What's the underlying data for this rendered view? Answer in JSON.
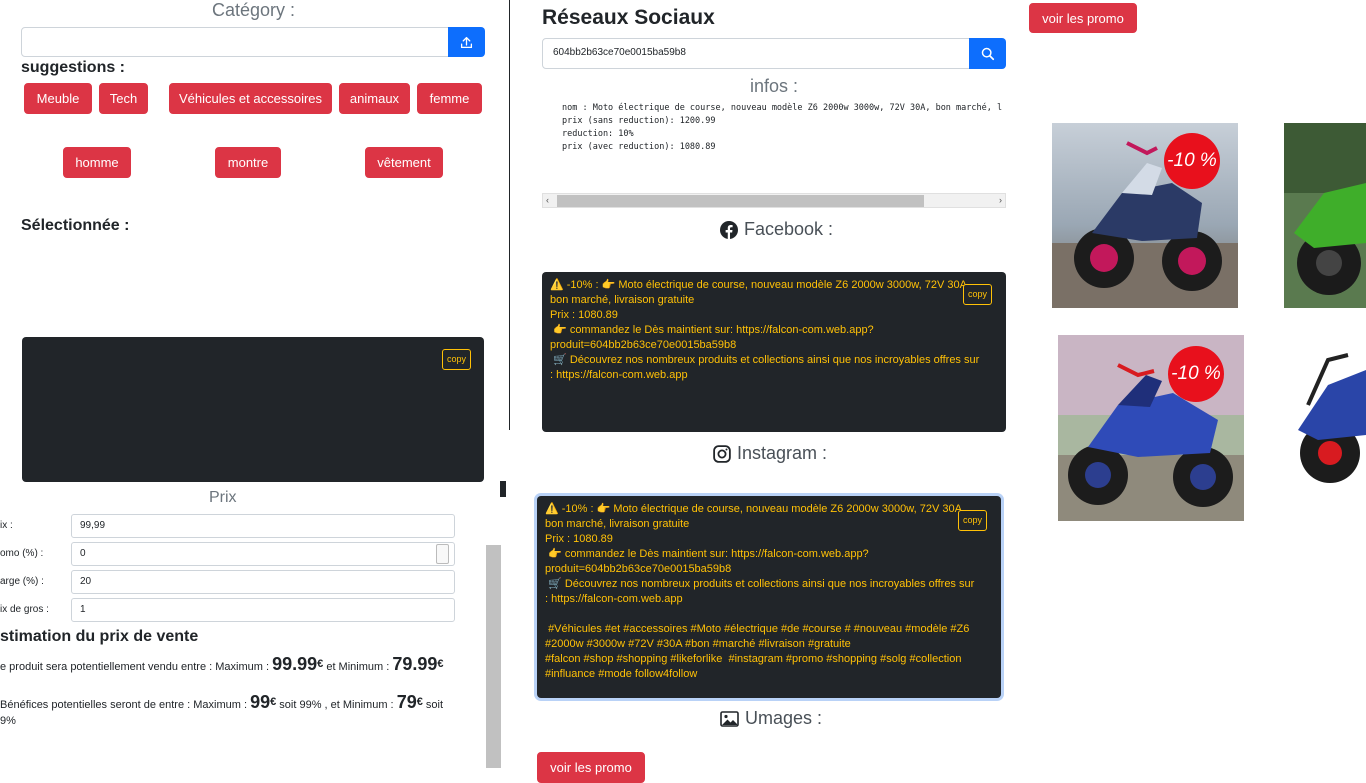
{
  "category": {
    "title": "Catégory :",
    "suggestions_label": "suggestions :",
    "suggestions": [
      "Meuble",
      "Tech",
      "Véhicules et accessoires",
      "animaux",
      "femme",
      "homme",
      "montre",
      "vêtement"
    ],
    "selected_label": "Sélectionnée :",
    "copy_label": "copy"
  },
  "prix": {
    "title": "Prix",
    "fields": [
      {
        "label": "ix :",
        "value": "99,99"
      },
      {
        "label": "omo (%) :",
        "value": "0"
      },
      {
        "label": "arge (%) :",
        "value": "20"
      },
      {
        "label": "ix de gros :",
        "value": "1"
      }
    ],
    "estimation_title": "stimation du prix de vente",
    "line1_prefix": "e produit sera potentiellement vendu entre : Maximum :",
    "line1_max": "99.99",
    "line1_mid": "et Minimum :",
    "line1_min": "79.99",
    "currency": "€",
    "line2_prefix": "Bénéfices potentielles seront de entre : Maximum :",
    "line2_max": "99",
    "line2_mid": "soit 99% , et Minimum :",
    "line2_min": "79",
    "line2_suffix": "soit",
    "line2_end": "9%"
  },
  "reseaux": {
    "title": "Réseaux Sociaux",
    "search_value": "604bb2b63ce70e0015ba59b8",
    "infos_title": "infos :",
    "infos_lines": [
      "nom : Moto électrique de course, nouveau modèle Z6 2000w 3000w, 72V 30A, bon marché, li",
      "prix (sans reduction): 1200.99",
      "reduction: 10%",
      "prix (avec reduction): 1080.89"
    ],
    "facebook_title": "Facebook :",
    "facebook_text": "⚠️ -10% : 👉 Moto électrique de course, nouveau modèle Z6 2000w 3000w, 72V 30A, bon marché, livraison gratuite\nPrix : 1080.89\n 👉 commandez le Dès maintient sur: https://falcon-com.web.app?produit=604bb2b63ce70e0015ba59b8\n 🛒 Découvrez nos nombreux produits et collections ainsi que nos incroyables offres sur : https://falcon-com.web.app",
    "instagram_title": "Instagram :",
    "instagram_text": "⚠️ -10% : 👉 Moto électrique de course, nouveau modèle Z6 2000w 3000w, 72V 30A, bon marché, livraison gratuite\nPrix : 1080.89\n 👉 commandez le Dès maintient sur: https://falcon-com.web.app?produit=604bb2b63ce70e0015ba59b8\n 🛒 Découvrez nos nombreux produits et collections ainsi que nos incroyables offres sur : https://falcon-com.web.app\n\n #Véhicules #et #accessoires #Moto #électrique #de #course # #nouveau #modèle #Z6 #2000w #3000w #72V #30A #bon #marché #livraison #gratuite\n#falcon #shop #shopping #likeforlike  #instagram #promo #shopping #solg #collection #influance #mode follow4follow",
    "images_title": "Umages :",
    "promo_button": "voir les promo",
    "copy_label": "copy"
  },
  "right": {
    "promo_button": "voir les promo",
    "badge": "-10 %"
  },
  "colors": {
    "red": "#dc3545",
    "blue": "#0d6efd",
    "dark": "#212529",
    "yellow": "#ffc107"
  }
}
